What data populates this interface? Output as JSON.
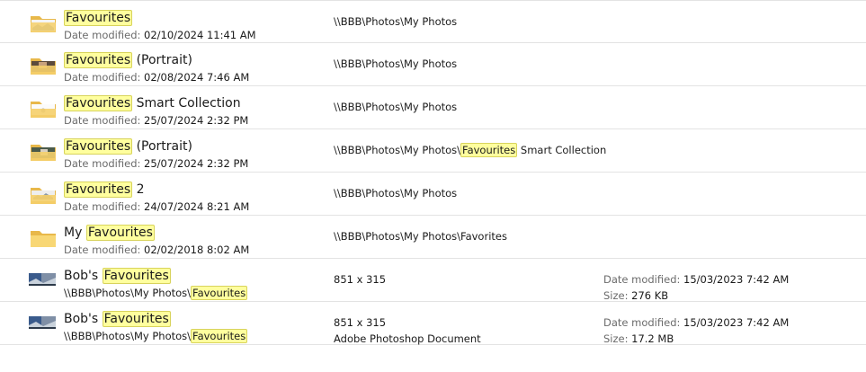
{
  "highlight_color": "#ffff9e",
  "labels": {
    "date_modified": "Date modified:",
    "size": "Size:"
  },
  "results": [
    {
      "thumbnail": "folder-icon-with-photo",
      "title_parts": [
        "Favourites",
        ""
      ],
      "date": "02/10/2024 11:41 AM",
      "location_parts": [
        "\\\\BBB\\Photos\\My Photos",
        "",
        ""
      ]
    },
    {
      "thumbnail": "folder-icon-with-photo",
      "title_parts": [
        "Favourites",
        " (Portrait)"
      ],
      "date": "02/08/2024 7:46 AM",
      "location_parts": [
        "\\\\BBB\\Photos\\My Photos",
        "",
        ""
      ]
    },
    {
      "thumbnail": "folder-icon-with-photo",
      "title_parts": [
        "Favourites",
        " Smart Collection"
      ],
      "date": "25/07/2024 2:32 PM",
      "location_parts": [
        "\\\\BBB\\Photos\\My Photos",
        "",
        ""
      ]
    },
    {
      "thumbnail": "folder-icon-with-photo",
      "title_parts": [
        "Favourites",
        " (Portrait)"
      ],
      "date": "25/07/2024 2:32 PM",
      "location_parts": [
        "\\\\BBB\\Photos\\My Photos\\",
        "Favourites",
        " Smart Collection"
      ]
    },
    {
      "thumbnail": "folder-icon-with-photo",
      "title_parts": [
        "Favourites",
        " 2"
      ],
      "date": "24/07/2024 8:21 AM",
      "location_parts": [
        "\\\\BBB\\Photos\\My Photos",
        "",
        ""
      ]
    },
    {
      "thumbnail": "folder-icon",
      "title_prefix": "My ",
      "title_parts": [
        "Favourites",
        ""
      ],
      "date": "02/02/2018 8:02 AM",
      "location_parts": [
        "\\\\BBB\\Photos\\My Photos\\Favorites",
        "",
        ""
      ]
    },
    {
      "thumbnail": "image-file-icon",
      "title_prefix": "Bob's ",
      "title_parts": [
        "Favourites",
        ""
      ],
      "path_parts": [
        "\\\\BBB\\Photos\\My Photos\\",
        "Favourites"
      ],
      "dimensions": "851 x 315",
      "date": "15/03/2023 7:42 AM",
      "size": "276 KB"
    },
    {
      "thumbnail": "image-file-icon",
      "title_prefix": "Bob's ",
      "title_parts": [
        "Favourites",
        ""
      ],
      "path_parts": [
        "\\\\BBB\\Photos\\My Photos\\",
        "Favourites"
      ],
      "dimensions": "851 x 315",
      "type": "Adobe Photoshop Document",
      "date": "15/03/2023 7:42 AM",
      "size": "17.2 MB"
    }
  ]
}
